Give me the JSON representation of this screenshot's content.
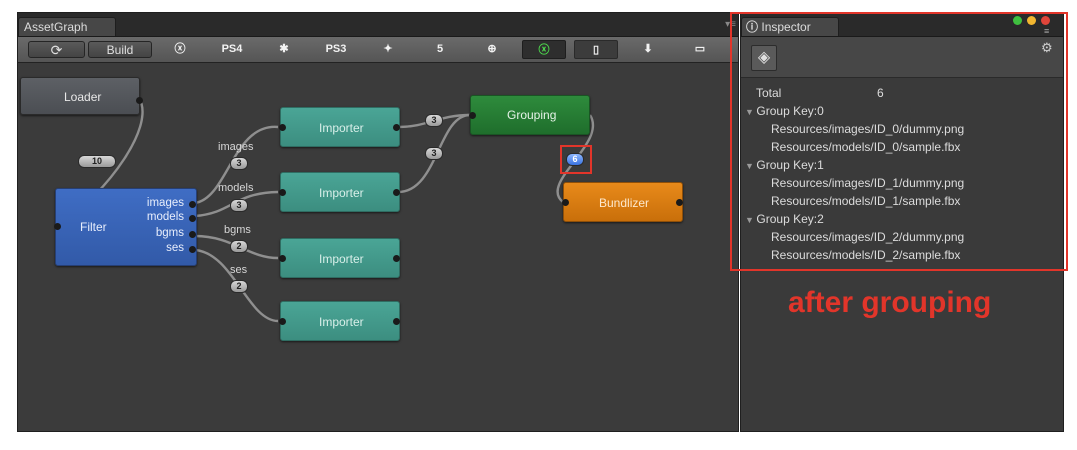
{
  "asset_graph": {
    "tab_title": "AssetGraph",
    "menu_icon": "menu-icon",
    "toolbar": {
      "refresh_icon": "refresh-icon",
      "build_label": "Build",
      "platforms": [
        {
          "name": "xbox-icon",
          "glyph": "ⓧ"
        },
        {
          "name": "ps4-icon",
          "glyph": "PS4"
        },
        {
          "name": "android-icon",
          "glyph": "✱"
        },
        {
          "name": "ps3-icon",
          "glyph": "PS3"
        },
        {
          "name": "unity-icon",
          "glyph": "✦"
        },
        {
          "name": "html5-icon",
          "glyph": "5"
        },
        {
          "name": "globe-icon",
          "glyph": "⊕"
        },
        {
          "name": "xbox-one-icon",
          "glyph": "ⓧ"
        },
        {
          "name": "mobile-icon",
          "glyph": "▯"
        },
        {
          "name": "download-icon",
          "glyph": "⬇"
        },
        {
          "name": "gamepad-icon",
          "glyph": "▭"
        }
      ]
    },
    "nodes": {
      "loader": "Loader",
      "filter": "Filter",
      "filter_outputs": [
        "images",
        "models",
        "bgms",
        "ses"
      ],
      "importer": "Importer",
      "grouping": "Grouping",
      "bundlizer": "Bundlizer"
    },
    "wire_labels": [
      "images",
      "models",
      "bgms",
      "ses"
    ],
    "counts": {
      "loader_to_filter": "10",
      "images": "3",
      "models": "3",
      "bgms": "2",
      "ses": "2",
      "importer1_to_grouping": "3",
      "importer2_to_grouping": "3",
      "grouping_to_bundlizer": "6"
    }
  },
  "inspector": {
    "tab_title": "Inspector",
    "info_icon": "info-icon",
    "traffic_lights": [
      "#3fbf3f",
      "#f2b630",
      "#e0453a"
    ],
    "unity_logo": "unity-logo-icon",
    "gear_icon": "gear-icon",
    "total_label": "Total",
    "total_value": "6",
    "groups": [
      {
        "key": "Group Key:0",
        "items": [
          "Resources/images/ID_0/dummy.png",
          "Resources/models/ID_0/sample.fbx"
        ]
      },
      {
        "key": "Group Key:1",
        "items": [
          "Resources/images/ID_1/dummy.png",
          "Resources/models/ID_1/sample.fbx"
        ]
      },
      {
        "key": "Group Key:2",
        "items": [
          "Resources/images/ID_2/dummy.png",
          "Resources/models/ID_2/sample.fbx"
        ]
      }
    ]
  },
  "annotation": {
    "caption": "after grouping",
    "color": "#e2352a"
  }
}
